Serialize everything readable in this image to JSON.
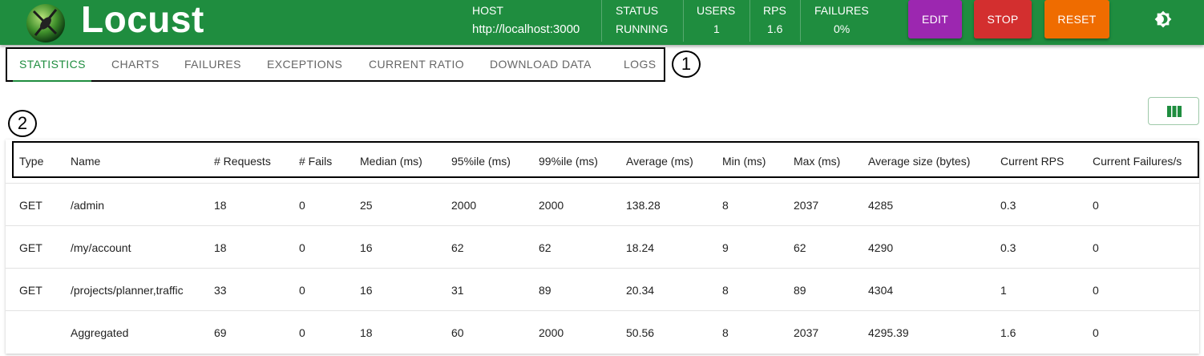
{
  "header": {
    "brand": "Locust",
    "host": {
      "label": "HOST",
      "value": "http://localhost:3000"
    },
    "status": {
      "label": "STATUS",
      "value": "RUNNING"
    },
    "users": {
      "label": "USERS",
      "value": "1"
    },
    "rps": {
      "label": "RPS",
      "value": "1.6"
    },
    "failures": {
      "label": "FAILURES",
      "value": "0%"
    },
    "buttons": {
      "edit": "EDIT",
      "stop": "STOP",
      "reset": "RESET"
    },
    "icons": {
      "logo": "locust-logo-icon",
      "theme": "brightness-icon"
    },
    "colors": {
      "bar": "#1f8d3f",
      "edit": "#9c27b0",
      "stop": "#d32f2f",
      "reset": "#ef6c00"
    }
  },
  "tabs": [
    {
      "label": "STATISTICS",
      "active": true
    },
    {
      "label": "CHARTS"
    },
    {
      "label": "FAILURES"
    },
    {
      "label": "EXCEPTIONS"
    },
    {
      "label": "CURRENT RATIO"
    },
    {
      "label": "DOWNLOAD DATA"
    },
    {
      "label": "LOGS"
    }
  ],
  "callouts": {
    "one": "1",
    "two": "2"
  },
  "table": {
    "columns": [
      "Type",
      "Name",
      "# Requests",
      "# Fails",
      "Median (ms)",
      "95%ile (ms)",
      "99%ile (ms)",
      "Average (ms)",
      "Min (ms)",
      "Max (ms)",
      "Average size (bytes)",
      "Current RPS",
      "Current Failures/s"
    ],
    "rows": [
      [
        "GET",
        "/admin",
        "18",
        "0",
        "25",
        "2000",
        "2000",
        "138.28",
        "8",
        "2037",
        "4285",
        "0.3",
        "0"
      ],
      [
        "GET",
        "/my/account",
        "18",
        "0",
        "16",
        "62",
        "62",
        "18.24",
        "9",
        "62",
        "4290",
        "0.3",
        "0"
      ],
      [
        "GET",
        "/projects/planner,traffic",
        "33",
        "0",
        "16",
        "31",
        "89",
        "20.34",
        "8",
        "89",
        "4304",
        "1",
        "0"
      ],
      [
        "",
        "Aggregated",
        "69",
        "0",
        "18",
        "60",
        "2000",
        "50.56",
        "8",
        "2037",
        "4295.39",
        "1.6",
        "0"
      ]
    ]
  }
}
